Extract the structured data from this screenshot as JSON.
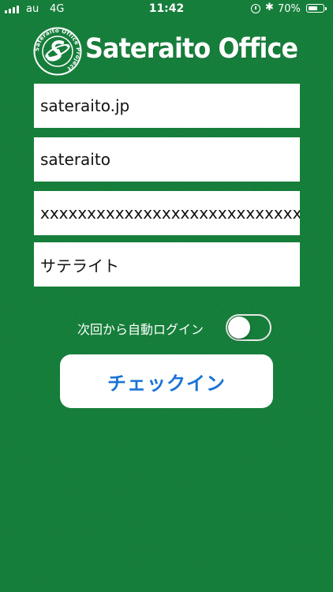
{
  "status_bar": {
    "carrier": "au",
    "network": "4G",
    "time": "11:42",
    "battery_percent": "70%",
    "battery_level": 0.7,
    "icons": [
      "signal-icon",
      "alarm-icon",
      "bluetooth-icon",
      "battery-icon"
    ]
  },
  "logo": {
    "title": "Sateraito Office",
    "emblem_text": "Sateraito Office Project"
  },
  "form": {
    "domain": "sateraito.jp",
    "user_id": "sateraito",
    "password": "xxxxxxxxxxxxxxxxxxxxxxxxxxxxx",
    "display_name": "サテライト"
  },
  "auto_login": {
    "label": "次回から自動ログイン",
    "enabled": false
  },
  "checkin_button": {
    "label": "チェックイン"
  },
  "colors": {
    "background": "#14803a",
    "button_text": "#1a73d6",
    "field_background": "#ffffff"
  }
}
